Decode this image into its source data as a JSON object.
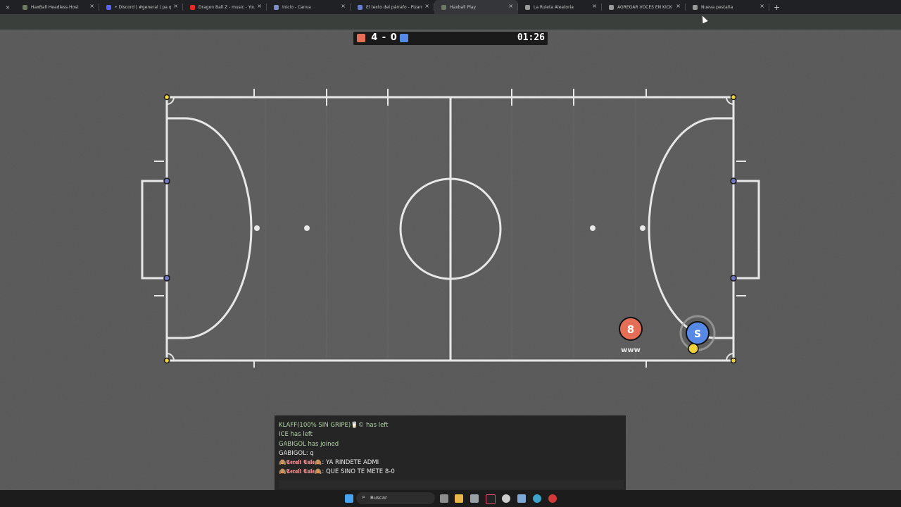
{
  "browser": {
    "tabs": [
      {
        "title": "HaxBall Headless Host",
        "favicon_color": "#6b7a65",
        "active": false
      },
      {
        "title": "• Discord | #general | pa que lo",
        "favicon_color": "#5865f2",
        "active": false
      },
      {
        "title": "Dragon Ball Z - music - You",
        "favicon_color": "#e52d27",
        "active": false
      },
      {
        "title": "Inicio - Canva",
        "favicon_color": "#7d8ec9",
        "active": false
      },
      {
        "title": "El texto del párrafo - Pizarra en",
        "favicon_color": "#6a7ccf",
        "active": false
      },
      {
        "title": "Haxball Play",
        "favicon_color": "#6b7a65",
        "active": true
      },
      {
        "title": "La Ruleta Aleatoria",
        "favicon_color": "#9a9a9a",
        "active": false
      },
      {
        "title": "AGREGAR VOCES EN KICK - Bu",
        "favicon_color": "#9a9a9a",
        "active": false
      },
      {
        "title": "Nueva pestaña",
        "favicon_color": "#9a9a9a",
        "active": false
      }
    ],
    "close_glyph": "×",
    "new_tab_glyph": "+"
  },
  "game": {
    "score": "4 - 0",
    "clock": "01:26",
    "team_colors": {
      "red": "#e56e56",
      "blue": "#5689e5"
    },
    "players": [
      {
        "team": "red",
        "avatar": "8",
        "name": "www"
      },
      {
        "team": "blue",
        "avatar": "S",
        "name": ""
      }
    ]
  },
  "chat": {
    "lines": [
      {
        "type": "sys",
        "text": "KLAFF(100% SIN GRIPE)🥛© has left"
      },
      {
        "type": "sys",
        "text": "ICE has left"
      },
      {
        "type": "sys",
        "text": "GABIGOL has joined"
      },
      {
        "type": "msg",
        "prefix": "",
        "text": "GABIGOL: q"
      },
      {
        "type": "msg",
        "prefix": "🙈𝕮𝖊𝖗𝖆𝖑𝖎 𝕮𝖚𝖑𝖊🙈",
        "text": ": YA RINDETE ADMI"
      },
      {
        "type": "msg",
        "prefix": "🙈𝕮𝖊𝖗𝖆𝖑𝖎 𝕮𝖚𝖑𝖊🙈",
        "text": ": QUE SINO TE METE 8-0"
      }
    ],
    "input_value": ""
  },
  "taskbar": {
    "search_label": "Buscar",
    "icons": [
      "windows-icon",
      "file-explorer-icon",
      "folder-icon",
      "edit-icon",
      "tiktok-icon",
      "chrome-icon",
      "notepad-icon",
      "edge-icon",
      "opera-icon"
    ]
  }
}
